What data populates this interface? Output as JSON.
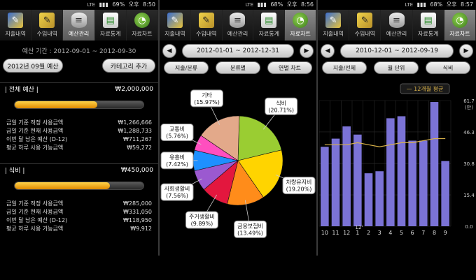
{
  "panels": {
    "p1": {
      "status": {
        "network": "LTE",
        "battery": "69%",
        "ampm": "오후",
        "time": "8:50"
      },
      "tabs": [
        {
          "label": "지출내역",
          "icon": "pen-icon",
          "active": false
        },
        {
          "label": "수입내역",
          "icon": "note-icon",
          "active": false
        },
        {
          "label": "예산관리",
          "icon": "database-icon",
          "active": true
        },
        {
          "label": "자료통계",
          "icon": "document-icon",
          "active": false
        },
        {
          "label": "자료차트",
          "icon": "pie-chart-icon",
          "active": false
        }
      ],
      "period_label": "예산 기간 : 2012-09-01 ~ 2012-09-30",
      "budget_button": "2012년 09월 예산",
      "category_add_button": "카테고리 추가",
      "sections": [
        {
          "title": "| 전체 예산 |",
          "amount": "₩2,000,000",
          "progress": 0.64,
          "rows": [
            {
              "label": "금일 기준 적정 사용금액",
              "value": "₩1,266,666"
            },
            {
              "label": "금일 기준 현재 사용금액",
              "value": "₩1,288,733"
            },
            {
              "label": "이번 달 남은 예산 (D-12)",
              "value": "₩711,267"
            },
            {
              "label": "평균 하루 사용 가능금액",
              "value": "₩59,272"
            }
          ]
        },
        {
          "title": "| 식비 |",
          "amount": "₩450,000",
          "progress": 0.74,
          "rows": [
            {
              "label": "금일 기준 적정 사용금액",
              "value": "₩285,000"
            },
            {
              "label": "금일 기준 현재 사용금액",
              "value": "₩331,050"
            },
            {
              "label": "이번 달 남은 예산 (D-12)",
              "value": "₩118,950"
            },
            {
              "label": "평균 하루 사용 가능금액",
              "value": "₩9,912"
            }
          ]
        }
      ]
    },
    "p2": {
      "status": {
        "network": "LTE",
        "battery": "68%",
        "ampm": "오후",
        "time": "8:56"
      },
      "tabs": [
        {
          "label": "지출내역",
          "icon": "pen-icon",
          "active": false
        },
        {
          "label": "수입내역",
          "icon": "note-icon",
          "active": false
        },
        {
          "label": "예산관리",
          "icon": "database-icon",
          "active": false
        },
        {
          "label": "자료통계",
          "icon": "document-icon",
          "active": false
        },
        {
          "label": "자료차트",
          "icon": "pie-chart-icon",
          "active": true
        }
      ],
      "prev_label": "◀",
      "next_label": "▶",
      "date_range": "2012-01-01 ~ 2012-12-31",
      "filters": [
        "지출/분류",
        "분류별",
        "연별 차트"
      ]
    },
    "p3": {
      "status": {
        "network": "LTE",
        "battery": "68%",
        "ampm": "오후",
        "time": "8:57"
      },
      "tabs": [
        {
          "label": "지출내역",
          "icon": "pen-icon",
          "active": false
        },
        {
          "label": "수입내역",
          "icon": "note-icon",
          "active": false
        },
        {
          "label": "예산관리",
          "icon": "database-icon",
          "active": false
        },
        {
          "label": "자료통계",
          "icon": "document-icon",
          "active": false
        },
        {
          "label": "자료차트",
          "icon": "pie-chart-icon",
          "active": true
        }
      ],
      "prev_label": "◀",
      "next_label": "▶",
      "date_range": "2010-12-01 ~ 2012-09-19",
      "filters": [
        "지출/전체",
        "월 단위",
        "식비"
      ]
    }
  },
  "colors": {
    "pie": [
      "#9acd32",
      "#ffd400",
      "#ff8c1a",
      "#e3173e",
      "#9b59d0",
      "#1e90ff",
      "#ff4fbf",
      "#e3a98a"
    ],
    "bar": "#7b73d6",
    "avg_line": "#d9b24a"
  },
  "chart_data": [
    {
      "type": "pie",
      "slices": [
        {
          "label": "식비",
          "pct": 20.71
        },
        {
          "label": "차량유지비",
          "pct": 19.2
        },
        {
          "label": "금융보험비",
          "pct": 13.49
        },
        {
          "label": "주거생활비",
          "pct": 9.89
        },
        {
          "label": "사회생활비",
          "pct": 7.56
        },
        {
          "label": "유흥비",
          "pct": 7.42
        },
        {
          "label": "교통비",
          "pct": 5.76
        },
        {
          "label": "기타",
          "pct": 15.97
        }
      ]
    },
    {
      "type": "bar",
      "categories": [
        "10",
        "11",
        "12",
        "1",
        "2",
        "3",
        "4",
        "5",
        "6",
        "7",
        "8",
        "9"
      ],
      "year_marker": {
        "label": "12'",
        "category": "1"
      },
      "values": [
        39,
        43,
        49,
        45,
        26,
        27,
        53,
        54,
        42,
        42,
        61,
        32
      ],
      "avg_line": [
        40,
        40,
        40,
        41,
        40,
        39,
        40,
        41,
        41,
        42,
        43,
        43
      ],
      "legend": "— 12개월 평균",
      "ylim": [
        0,
        61.7
      ],
      "ytick_values": [
        0,
        15.4,
        30.8,
        46.3,
        61.7
      ],
      "ytick_labels": [
        "0.0",
        "15.4",
        "30.8",
        "46.3",
        "61.7"
      ],
      "unit": "(만)"
    }
  ]
}
